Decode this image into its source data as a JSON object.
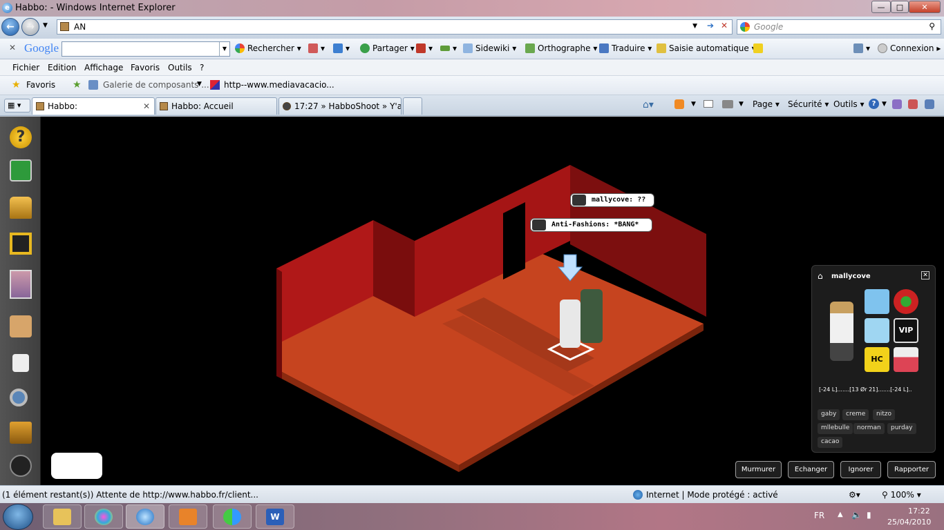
{
  "window": {
    "title": "Habbo: - Windows Internet Explorer",
    "min": "—",
    "max": "□",
    "close": "✕"
  },
  "address": {
    "value": "AN",
    "search_placeholder": "Google"
  },
  "google_toolbar": {
    "logo": "Google",
    "items": [
      "Rechercher",
      "Partager",
      "Sidewiki",
      "Orthographe",
      "Traduire",
      "Saisie automatique",
      "Connexion"
    ]
  },
  "menu": [
    "Fichier",
    "Edition",
    "Affichage",
    "Favoris",
    "Outils",
    "?"
  ],
  "favorites": {
    "label": "Favoris",
    "links": [
      "Galerie de composants ...",
      "http--www.mediavacacio..."
    ]
  },
  "tabs": [
    {
      "label": "Habbo:",
      "active": true
    },
    {
      "label": "Habbo: Accueil",
      "active": false
    },
    {
      "label": "17:27 » HabboShoot » Y'a ...",
      "active": false
    }
  ],
  "command_bar": [
    "Page",
    "Sécurité",
    "Outils"
  ],
  "game": {
    "bubbles": [
      {
        "user": "mallycove:",
        "text": "??"
      },
      {
        "user": "Anti-Fashions:",
        "text": "*BANG*"
      }
    ],
    "profile": {
      "name": "mallycove",
      "motto": "[-24 L].......[13 Ør 21].......[-24 L]..",
      "tags": [
        "gaby",
        "creme",
        "nitzo",
        "mllebulle",
        "norman",
        "purday",
        "cacao"
      ],
      "badges": [
        "fish-badge",
        "clock-badge",
        "ice-badge",
        "vip-badge",
        "hc-badge",
        "house-badge"
      ]
    },
    "actions": [
      "Murmurer",
      "Echanger",
      "Ignorer",
      "Rapporter"
    ],
    "left_icons": [
      "help-icon",
      "navigator-icon",
      "catalog-icon",
      "room-icon",
      "inventory-icon",
      "hand-icon",
      "chat-icon",
      "search-icon",
      "furni-icon",
      "avatar-icon"
    ]
  },
  "status": {
    "text": "(1 élément restant(s)) Attente de http://www.habbo.fr/client...",
    "zone": "Internet | Mode protégé : activé",
    "zoom": "100%"
  },
  "taskbar": {
    "lang": "FR",
    "time": "17:22",
    "date": "25/04/2010"
  },
  "colors": {
    "wall": "#8a0f0f",
    "floor": "#c6441f",
    "panel": "#1c1c1c"
  }
}
